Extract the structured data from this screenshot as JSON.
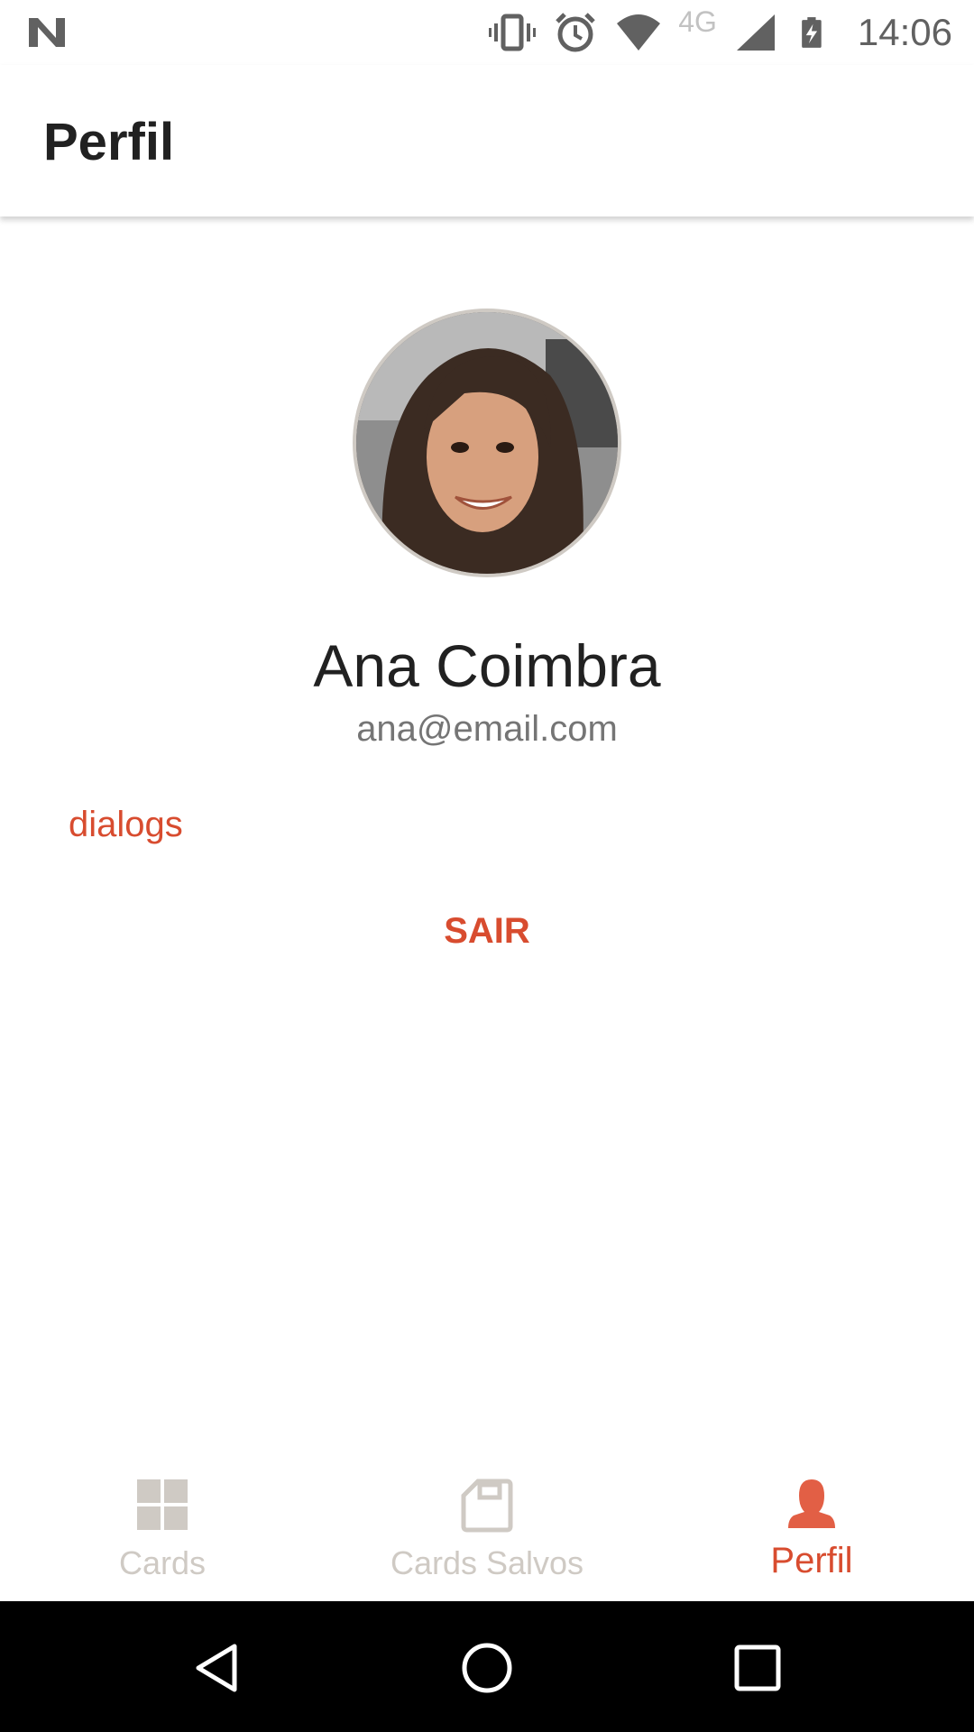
{
  "status_bar": {
    "time": "14:06",
    "network": "4G",
    "icons": [
      "n-logo-icon",
      "vibrate-icon",
      "alarm-icon",
      "wifi-icon",
      "signal-icon",
      "battery-charging-icon"
    ]
  },
  "app_bar": {
    "title": "Perfil"
  },
  "profile": {
    "name": "Ana Coimbra",
    "email": "ana@email.com",
    "avatar_icon": "user-photo-avatar"
  },
  "actions": {
    "dialogs_label": "dialogs",
    "logout_label": "SAIR"
  },
  "bottom_nav": {
    "items": [
      {
        "label": "Cards",
        "icon": "grid-icon",
        "active": false
      },
      {
        "label": "Cards Salvos",
        "icon": "save-icon",
        "active": false
      },
      {
        "label": "Perfil",
        "icon": "person-icon",
        "active": true
      }
    ]
  },
  "system_nav": {
    "icons": [
      "back-icon",
      "home-icon",
      "recents-icon"
    ]
  },
  "colors": {
    "accent": "#d84c2f",
    "inactive": "#cfcac4",
    "text_primary": "#212121",
    "text_secondary": "#757575"
  }
}
